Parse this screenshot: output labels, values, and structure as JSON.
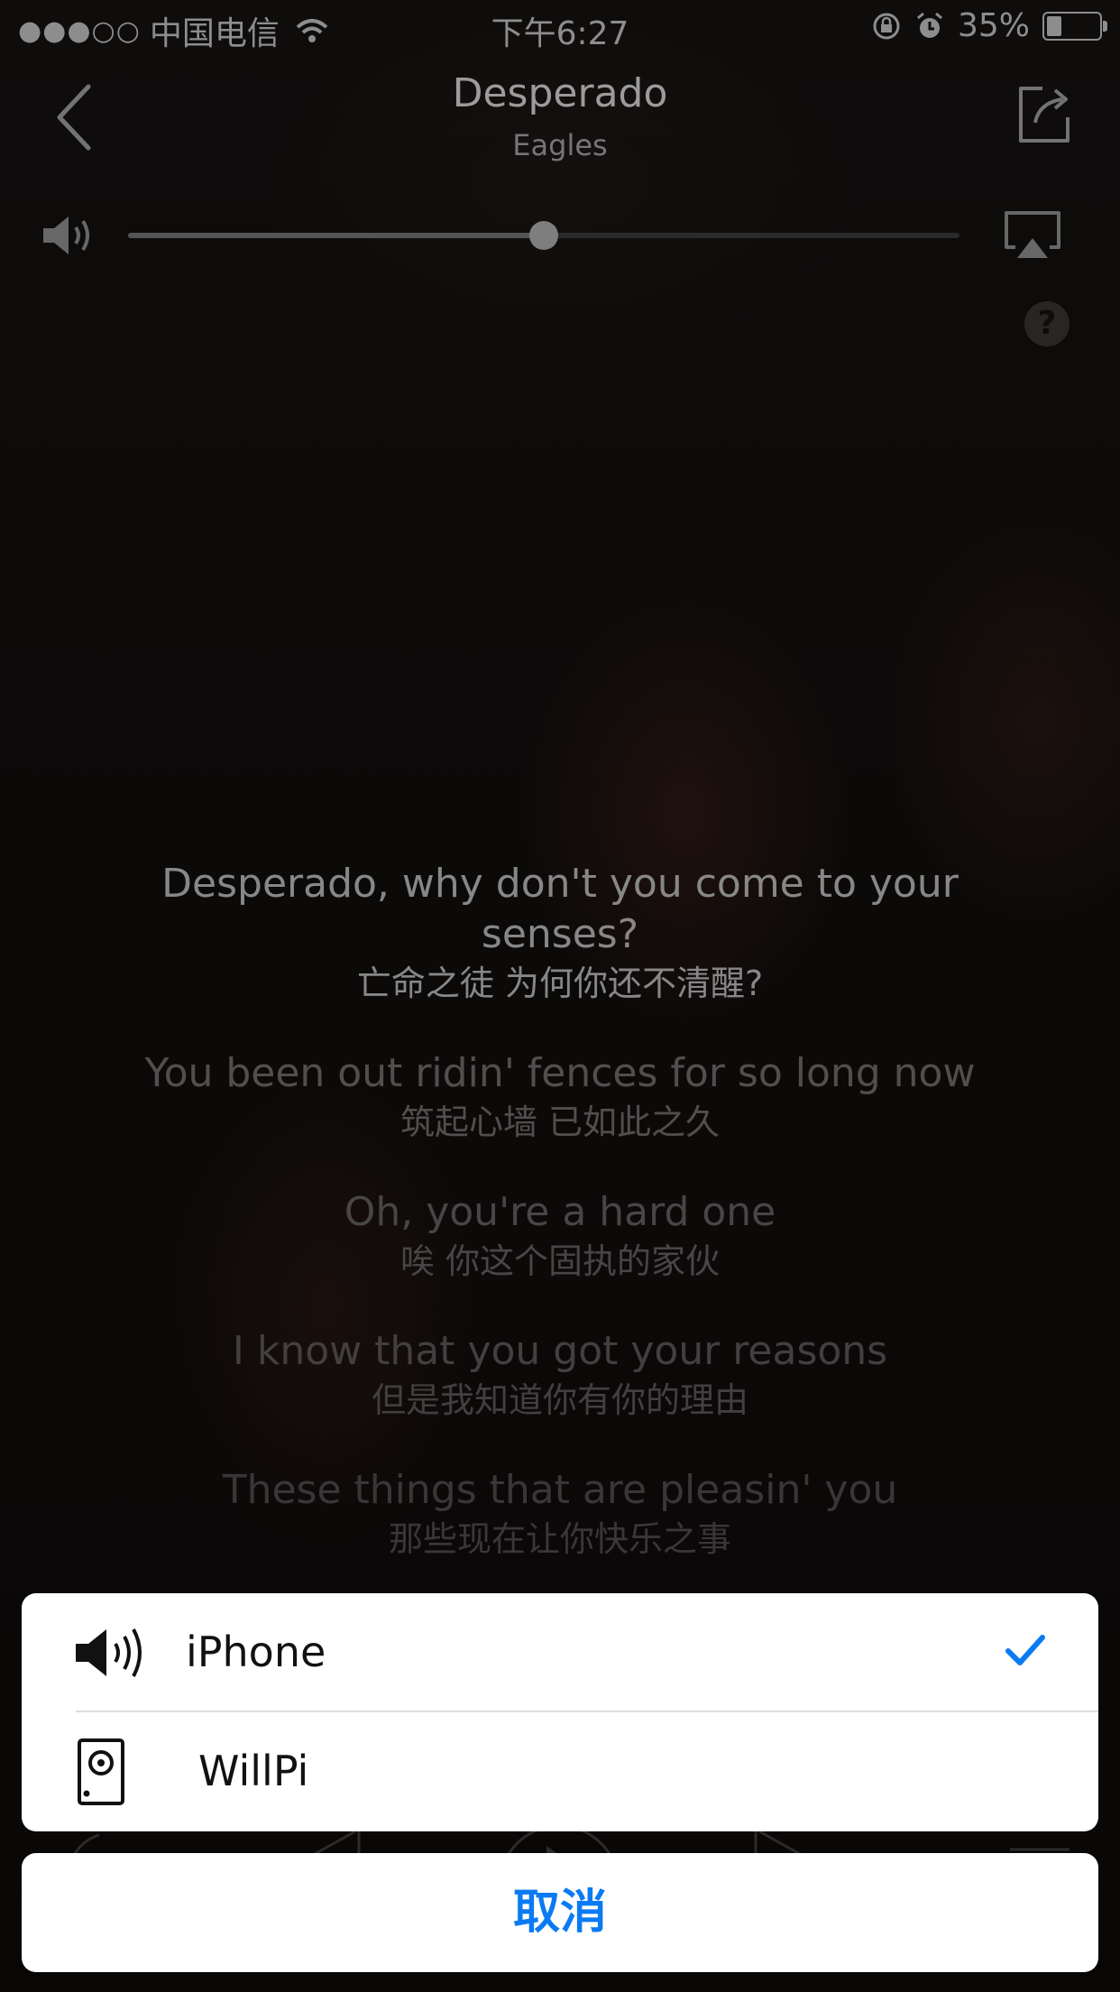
{
  "status_bar": {
    "signal": "●●●○○",
    "carrier": "中国电信",
    "time": "下午6:27",
    "battery_text": "35%",
    "battery_level": 0.35
  },
  "header": {
    "title": "Desperado",
    "artist": "Eagles"
  },
  "volume": {
    "level": 0.5
  },
  "help_label": "?",
  "lyrics": [
    {
      "en": "Desperado, why don't you come to your senses?",
      "zh": "亡命之徒 为何你还不清醒?"
    },
    {
      "en": "You been out ridin' fences for so long now",
      "zh": "筑起心墙 已如此之久"
    },
    {
      "en": "Oh, you're a hard one",
      "zh": "唉 你这个固执的家伙"
    },
    {
      "en": "I know that you got your reasons",
      "zh": "但是我知道你有你的理由"
    },
    {
      "en": "These things that are pleasin' you",
      "zh": "那些现在让你快乐之事"
    }
  ],
  "sheet": {
    "items": [
      {
        "label": "iPhone",
        "icon": "speaker-icon",
        "selected": true
      },
      {
        "label": "WillPi",
        "icon": "device-speaker-icon",
        "selected": false
      }
    ],
    "cancel_label": "取消"
  },
  "colors": {
    "accent": "#0a7bf2",
    "sheet_bg": "#ffffff"
  }
}
